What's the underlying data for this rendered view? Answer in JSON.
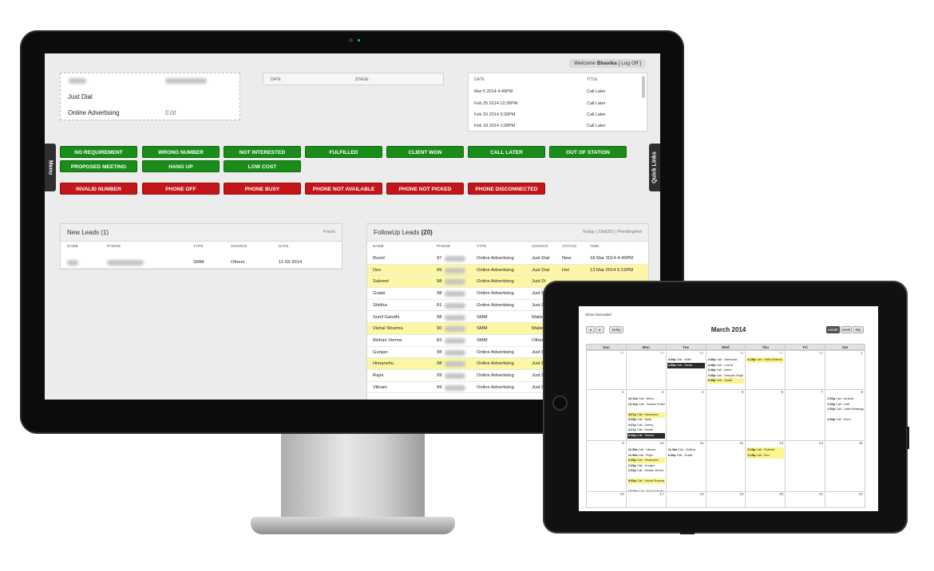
{
  "header": {
    "welcome_prefix": "Welcome",
    "user": "Bhavika",
    "logoff": "[ Log Off ]"
  },
  "lead_info": {
    "source": "Just Dial",
    "channel": "Online Advertising",
    "edit_label": "Edit"
  },
  "stage_table": {
    "date_header": "DATE",
    "stage_header": "STAGE"
  },
  "schedule_table": {
    "date_header": "DATE",
    "title_header": "TITLE",
    "rows": [
      {
        "date": "Mar 5 2014 4:49PM",
        "title": "Call Later"
      },
      {
        "date": "Feb 25 2014 12:36PM",
        "title": "Call Later"
      },
      {
        "date": "Feb 20 2014 3:33PM",
        "title": "Call Later"
      },
      {
        "date": "Feb 18 2014 1:00PM",
        "title": "Call Later"
      }
    ]
  },
  "side_tabs": {
    "menu": "Menu",
    "quick_links": "Quick Links"
  },
  "status_buttons": {
    "green": [
      "NO REQUIREMENT",
      "WRONG NUMBER",
      "NOT INTERESTED",
      "FULFILLED",
      "CLIENT WON",
      "CALL LATER",
      "OUT OF STATION",
      "PROPOSED MEETING",
      "HANG UP",
      "LOW COST"
    ],
    "red": [
      "INVALID NUMBER",
      "PHONE OFF",
      "PHONE BUSY",
      "PHONE NOT AVAILABLE",
      "PHONE NOT PICKED",
      "PHONE DISCONNECTED"
    ]
  },
  "new_leads": {
    "title": "New Leads",
    "count": "(1)",
    "action": "Fresh",
    "headers": [
      "NAME",
      "PHONE",
      "TYPE",
      "SOURCE",
      "DATE"
    ],
    "rows": [
      {
        "type": "SMM",
        "source": "Others",
        "date": "11-03-2014"
      }
    ]
  },
  "followup_leads": {
    "title": "FollowUp Leads",
    "count": "(20)",
    "filters": {
      "today": "Today",
      "sep1": "|",
      "old": "Old(25)",
      "sep2": "|",
      "pending": "PendingHot"
    },
    "headers": [
      "NAME",
      "PHONE",
      "TYPE",
      "SOURCE",
      "STATUS",
      "TIME"
    ],
    "rows": [
      {
        "name": "Rumil",
        "phone": "97",
        "type": "Online Advertising",
        "source": "Just Dial",
        "status": "New",
        "time": "18 Mar 2014 4:49PM",
        "hl": false
      },
      {
        "name": "Dev",
        "phone": "99",
        "type": "Online Advertising",
        "source": "Just Dial",
        "status": "Hot",
        "time": "13 Mar 2014 5:15PM",
        "hl": true
      },
      {
        "name": "Sukreet",
        "phone": "98",
        "type": "Online Advertising",
        "source": "Just Di",
        "status": "",
        "time": "",
        "hl": true
      },
      {
        "name": "Gulati",
        "phone": "98",
        "type": "Online Advertising",
        "source": "Just Di",
        "status": "",
        "time": "",
        "hl": false
      },
      {
        "name": "Shikha",
        "phone": "81",
        "type": "Online Advertising",
        "source": "Just Di",
        "status": "",
        "time": "",
        "hl": false
      },
      {
        "name": "Sunil Gandhi",
        "phone": "98",
        "type": "SMM",
        "source": "Mailer",
        "status": "",
        "time": "",
        "hl": false
      },
      {
        "name": "Vishal Sharma",
        "phone": "90",
        "type": "SMM",
        "source": "Mailer",
        "status": "",
        "time": "",
        "hl": true
      },
      {
        "name": "Mohan Verma",
        "phone": "83",
        "type": "SMM",
        "source": "Other",
        "status": "",
        "time": "",
        "hl": false
      },
      {
        "name": "Gunjan",
        "phone": "98",
        "type": "Online Advertising",
        "source": "Just Di",
        "status": "",
        "time": "",
        "hl": false
      },
      {
        "name": "Himanshu",
        "phone": "98",
        "type": "Online Advertising",
        "source": "Just D",
        "status": "",
        "time": "",
        "hl": true
      },
      {
        "name": "Rajni",
        "phone": "99",
        "type": "Online Advertising",
        "source": "Just D",
        "status": "",
        "time": "",
        "hl": false
      },
      {
        "name": "Vikram",
        "phone": "99",
        "type": "Online Advertising",
        "source": "Just D",
        "status": "",
        "time": "",
        "hl": false
      }
    ]
  },
  "calendar": {
    "show_discarded": "Show Discarded",
    "nav": {
      "prev": "◂",
      "next": "▸",
      "today": "today"
    },
    "views": [
      "month",
      "week",
      "day"
    ],
    "title": "March 2014",
    "days": [
      "Sun",
      "Mon",
      "Tue",
      "Wed",
      "Thu",
      "Fri",
      "Sat"
    ],
    "weeks": [
      [
        "23",
        "24",
        "25",
        "26",
        "27",
        "28",
        "1"
      ],
      [
        "2",
        "3",
        "4",
        "5",
        "6",
        "7",
        "8"
      ],
      [
        "9",
        "10",
        "11",
        "12",
        "13",
        "14",
        "15"
      ],
      [
        "16",
        "17",
        "18",
        "19",
        "20",
        "21",
        "22"
      ]
    ],
    "events": [
      {
        "w": 0,
        "d": 2,
        "i": 0,
        "time": "4:46p",
        "text": "Call : Nidhi",
        "hl": ""
      },
      {
        "w": 0,
        "d": 2,
        "i": 1,
        "time": "4:50p",
        "text": "Call : David",
        "hl": "dark"
      },
      {
        "w": 0,
        "d": 3,
        "i": 0,
        "time": "4:46p",
        "text": "Call : Narendra",
        "hl": ""
      },
      {
        "w": 0,
        "d": 3,
        "i": 1,
        "time": "4:46p",
        "text": "Call : Leena",
        "hl": ""
      },
      {
        "w": 0,
        "d": 3,
        "i": 2,
        "time": "4:46p",
        "text": "Call : Neha",
        "hl": ""
      },
      {
        "w": 0,
        "d": 3,
        "i": 3,
        "time": "4:46p",
        "text": "Call : Deepak Singh",
        "hl": ""
      },
      {
        "w": 0,
        "d": 3,
        "i": 4,
        "time": "5:45p",
        "text": "Call : Gulati",
        "hl": "yellow"
      },
      {
        "w": 0,
        "d": 4,
        "i": 0,
        "time": "6:15p",
        "text": "Call : Vidhi Khanna",
        "hl": "yellow"
      },
      {
        "w": 1,
        "d": 1,
        "i": 0,
        "time": "12:32a",
        "text": "Call : Nevin",
        "hl": ""
      },
      {
        "w": 1,
        "d": 1,
        "i": 1,
        "time": "12:41p",
        "text": "Call : Gaurav Khanna",
        "hl": ""
      },
      {
        "w": 1,
        "d": 1,
        "i": 3,
        "time": "4:07p",
        "text": "Call : Himanshu",
        "hl": "yellow"
      },
      {
        "w": 1,
        "d": 1,
        "i": 4,
        "time": "4:49p",
        "text": "Call : Nash",
        "hl": ""
      },
      {
        "w": 1,
        "d": 1,
        "i": 5,
        "time": "4:41p",
        "text": "Call : Sunny",
        "hl": ""
      },
      {
        "w": 1,
        "d": 1,
        "i": 6,
        "time": "4:47p",
        "text": "Call : Manik",
        "hl": ""
      },
      {
        "w": 1,
        "d": 1,
        "i": 7,
        "time": "5:46p",
        "text": "Call : Shekar",
        "hl": "dark"
      },
      {
        "w": 1,
        "d": 6,
        "i": 0,
        "time": "1:52p",
        "text": "Call : Arnaud",
        "hl": ""
      },
      {
        "w": 1,
        "d": 6,
        "i": 1,
        "time": "1:53p",
        "text": "Call : Lalit",
        "hl": ""
      },
      {
        "w": 1,
        "d": 6,
        "i": 2,
        "time": "1:54p",
        "text": "Call : Lalbir Bhatnagar Singh",
        "hl": ""
      },
      {
        "w": 1,
        "d": 6,
        "i": 4,
        "time": "1:54p",
        "text": "Call : Kohu",
        "hl": ""
      },
      {
        "w": 2,
        "d": 1,
        "i": 0,
        "time": "11:35a",
        "text": "Call : Vikram",
        "hl": ""
      },
      {
        "w": 2,
        "d": 1,
        "i": 1,
        "time": "11:36a",
        "text": "Call : Rajni",
        "hl": ""
      },
      {
        "w": 2,
        "d": 1,
        "i": 2,
        "time": "1:35p",
        "text": "Call : Himanshu",
        "hl": "yellow"
      },
      {
        "w": 2,
        "d": 1,
        "i": 3,
        "time": "2:49p",
        "text": "Call : Gunjan",
        "hl": ""
      },
      {
        "w": 2,
        "d": 1,
        "i": 4,
        "time": "2:52p",
        "text": "Call : Mohan Verma",
        "hl": ""
      },
      {
        "w": 2,
        "d": 1,
        "i": 6,
        "time": "5:50p",
        "text": "Call : Vishal Sharma",
        "hl": "yellow"
      },
      {
        "w": 2,
        "d": 1,
        "i": 8,
        "time": "12:52p",
        "text": "Call : Sunil Gandhi",
        "hl": ""
      },
      {
        "w": 2,
        "d": 2,
        "i": 0,
        "time": "11:36a",
        "text": "Call : Shikha",
        "hl": ""
      },
      {
        "w": 2,
        "d": 2,
        "i": 1,
        "time": "6:40p",
        "text": "Call : Gulati",
        "hl": ""
      },
      {
        "w": 2,
        "d": 4,
        "i": 0,
        "time": "3:15p",
        "text": "Call : Sukreet",
        "hl": "yellow"
      },
      {
        "w": 2,
        "d": 4,
        "i": 1,
        "time": "3:15p",
        "text": "Call : Dev",
        "hl": "yellow"
      }
    ]
  },
  "colors": {
    "green_button": "#1a8c1a",
    "red_button": "#c41519",
    "highlight_row": "#fcf7a4"
  }
}
